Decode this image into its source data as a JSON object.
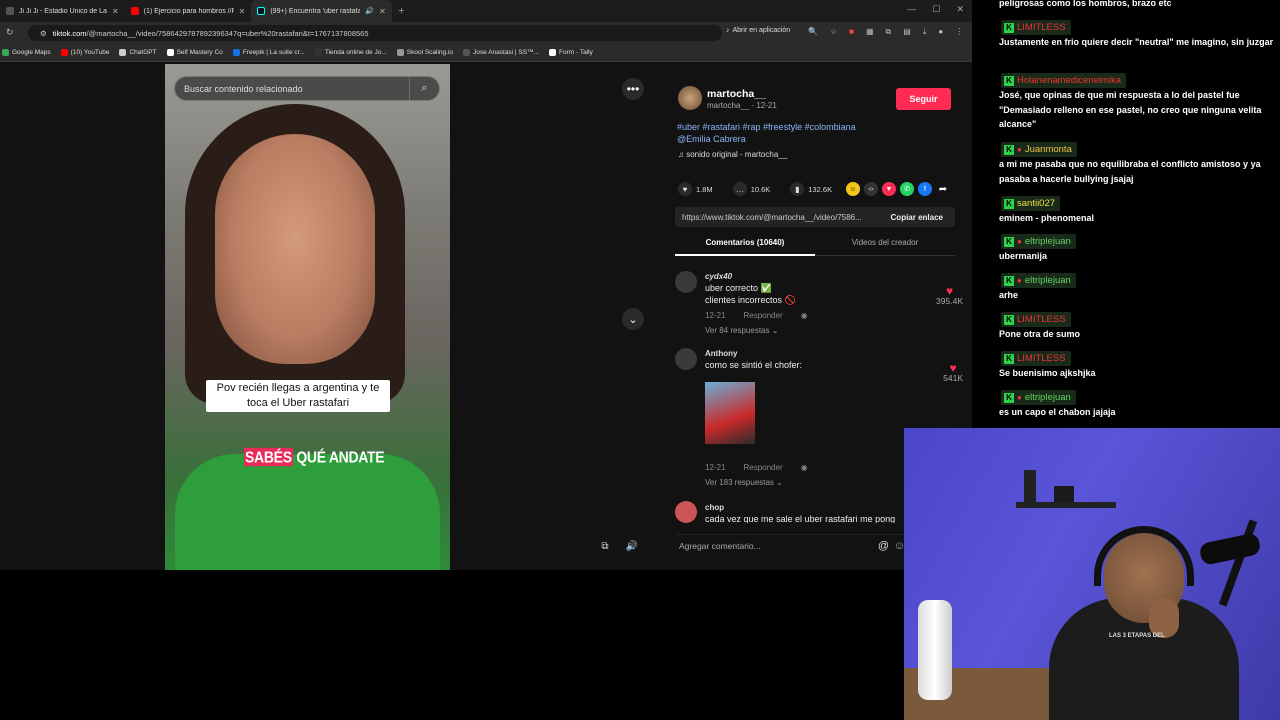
{
  "browser": {
    "tabs": [
      {
        "title": "Ji Ji Ji - Estadio Único de La",
        "color": "#555"
      },
      {
        "title": "(1) Ejercicio para hombros //Re",
        "color": "#ff0000"
      },
      {
        "title": "(99+) Encuentra 'uber rastafari",
        "color": "#111",
        "active": true
      }
    ],
    "url_domain": "tiktok.com",
    "url_path": "/@martocha__/video/7586429787892396347q=uber%20rastafari&t=1767137808565",
    "open_app_label": "Abrir en aplicación",
    "bookmarks": [
      {
        "label": "Google Maps",
        "color": "#34a853"
      },
      {
        "label": "(10) YouTube",
        "color": "#ff0000"
      },
      {
        "label": "ChatGPT",
        "color": "#ccc"
      },
      {
        "label": "Self Mastery Co",
        "color": "#fff"
      },
      {
        "label": "Freepik | La suite cr...",
        "color": "#1273eb"
      },
      {
        "label": "Tienda online de Jo...",
        "color": "#333"
      },
      {
        "label": "Skool Scaling.io",
        "color": "#999"
      },
      {
        "label": "Jose Anastasi | SS™...",
        "color": "#555"
      },
      {
        "label": "Form - Tally",
        "color": "#fff"
      }
    ]
  },
  "video": {
    "search_placeholder": "Buscar contenido relacionado",
    "caption": "Pov recién llegas a argentina y te toca el Uber rastafari",
    "subtitle_highlight": "SABÉS",
    "subtitle_rest": " QUÉ ANDATE"
  },
  "post": {
    "username": "martocha__",
    "user_sub": "martocha__ · 12-21",
    "follow_label": "Seguir",
    "tags": "#uber #rastafari #rap #freestyle #colombiana",
    "mention": "@Emilia Cabrera",
    "sound": "♫  sonido original - martocha__",
    "likes": "1.8M",
    "comments": "10.6K",
    "saves": "132.6K",
    "link": "https://www.tiktok.com/@martocha__/video/7586...",
    "copy_label": "Copiar enlace",
    "tab_comments": "Comentarios (10640)",
    "tab_creator": "Videos del creador"
  },
  "comments": [
    {
      "name": "cydx40",
      "line1": "uber correcto ✅",
      "line2": "clientes incorrectos 🚫",
      "date": "12-21",
      "reply": "Responder",
      "replies": "Ver 84 respuestas ⌄",
      "likes": "395.4K"
    },
    {
      "name": "Anthony",
      "line1": "como se sintió el chofer:",
      "date": "12-21",
      "reply": "Responder",
      "replies": "Ver 183 respuestas ⌄",
      "likes": "541K"
    },
    {
      "name": "chop",
      "line1": "cada vez que me sale el uber rastafari me pong"
    }
  ],
  "add_comment_placeholder": "Agregar comentario...",
  "chat": [
    {
      "type": "msg",
      "text": "peligrosas como los hombros, brazo etc"
    },
    {
      "type": "user",
      "name": "LIMITLESS",
      "color": "#e33",
      "dot": false
    },
    {
      "type": "msg",
      "text": "Justamente en frio quiere decir \"neutral\" me imagino, sin juzgar"
    },
    {
      "type": "user",
      "name": "Holanenamedicenelmika",
      "color": "#e33",
      "dot": false
    },
    {
      "type": "msg",
      "text": "José, que opinas de que mi respuesta a lo del pastel fue \"Demasiado relleno en ese pastel, no creo que ninguna velita alcance\""
    },
    {
      "type": "user",
      "name": "Juanmonta",
      "color": "#f0c040",
      "dot": true
    },
    {
      "type": "msg",
      "text": "a mi me pasaba que no equilibraba el conflicto amistoso y ya pasaba a hacerle bullying jsajaj"
    },
    {
      "type": "user",
      "name": "santii027",
      "color": "#f0e040",
      "dot": false
    },
    {
      "type": "msg",
      "text": "eminem - phenomenal"
    },
    {
      "type": "user",
      "name": "eltriplejuan",
      "color": "#5fd35f",
      "dot": true
    },
    {
      "type": "msg",
      "text": "ubermanija"
    },
    {
      "type": "user",
      "name": "eltriplejuan",
      "color": "#5fd35f",
      "dot": true
    },
    {
      "type": "msg",
      "text": "arhe"
    },
    {
      "type": "user",
      "name": "LIMITLESS",
      "color": "#e33",
      "dot": false
    },
    {
      "type": "msg",
      "text": "Pone otra de sumo"
    },
    {
      "type": "user",
      "name": "LIMITLESS",
      "color": "#e33",
      "dot": false
    },
    {
      "type": "msg",
      "text": "Se buenisimo ajkshjka"
    },
    {
      "type": "user",
      "name": "eltriplejuan",
      "color": "#5fd35f",
      "dot": true
    },
    {
      "type": "msg",
      "text": "es un capo el chabon jajaja"
    }
  ],
  "webcam": {
    "shirt_text": "LAS 3 ETAPAS DEL"
  }
}
